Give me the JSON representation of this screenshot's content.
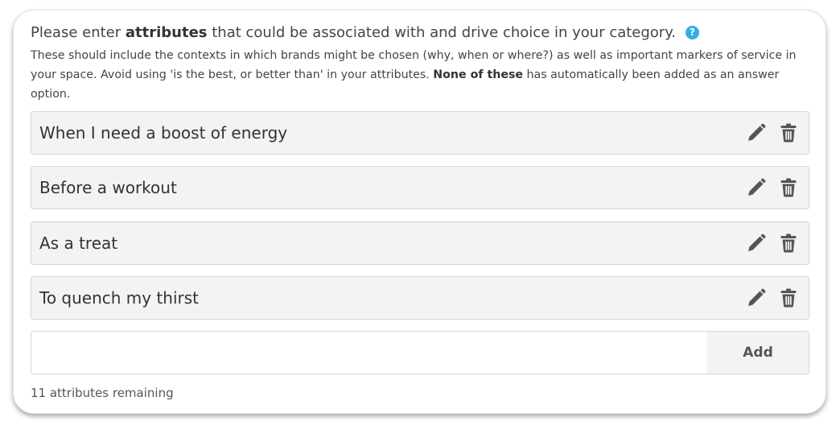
{
  "instructions": {
    "heading_pre": "Please enter ",
    "heading_bold": "attributes",
    "heading_post": " that could be associated with and drive choice in your category.",
    "help_glyph": "?",
    "desc_pre": "These should include the contexts in which brands might be chosen (why, when or where?) as well as important markers of service in your space. Avoid using 'is the best, or better than' in your attributes. ",
    "desc_bold": "None of these",
    "desc_post": " has automatically been added as an answer option."
  },
  "attributes": [
    {
      "label": "When I need a boost of energy"
    },
    {
      "label": "Before a workout"
    },
    {
      "label": "As a treat"
    },
    {
      "label": "To quench my thirst"
    }
  ],
  "add_form": {
    "input_value": "",
    "button_label": "Add"
  },
  "footer": {
    "remaining_text": "11 attributes remaining"
  },
  "icons": {
    "edit": "pencil-icon",
    "delete": "trash-icon",
    "help": "help-icon"
  },
  "colors": {
    "help_accent": "#33aee3",
    "item_bg": "#f3f3f3",
    "icon_color": "#555555"
  }
}
